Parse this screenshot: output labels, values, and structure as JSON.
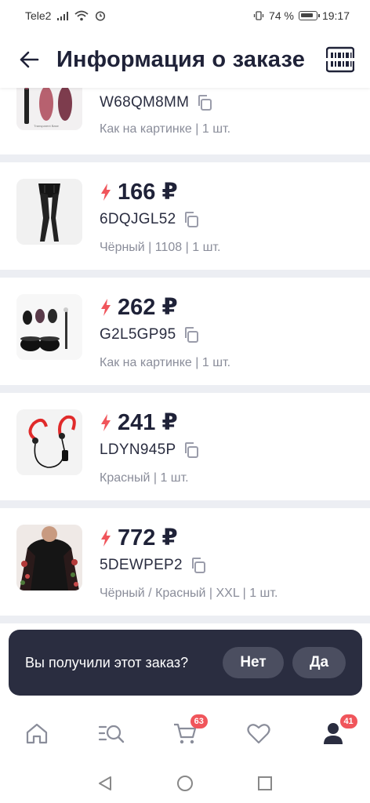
{
  "status_bar": {
    "carrier": "Tele2",
    "battery_percent": "74 %",
    "time": "19:17"
  },
  "header": {
    "title": "Информация о заказе"
  },
  "items": [
    {
      "price": "",
      "code": "W68QM8MM",
      "meta": "Как на картинке | 1 шт.",
      "image": "nail-polish-product"
    },
    {
      "price": "166 ₽",
      "code": "6DQJGL52",
      "meta": "Чёрный | 1108 | 1 шт.",
      "image": "stockings-product"
    },
    {
      "price": "262 ₽",
      "code": "G2L5GP95",
      "meta": "Как на картинке | 1 шт.",
      "image": "gel-polish-kit-product"
    },
    {
      "price": "241 ₽",
      "code": "LDYN945P",
      "meta": "Красный | 1 шт.",
      "image": "sport-earphones-product"
    },
    {
      "price": "772 ₽",
      "code": "5DEWPEP2",
      "meta": "Чёрный / Красный | XXL | 1 шт.",
      "image": "floral-blouse-product"
    }
  ],
  "prompt": {
    "question": "Вы получили этот заказ?",
    "no_label": "Нет",
    "yes_label": "Да"
  },
  "tabbar": {
    "cart_badge": "63",
    "profile_badge": "41"
  },
  "colors": {
    "accent": "#f0555b",
    "toast_bg": "#2a2d40",
    "text_primary": "#1f2238",
    "text_muted": "#8a8d9a"
  }
}
